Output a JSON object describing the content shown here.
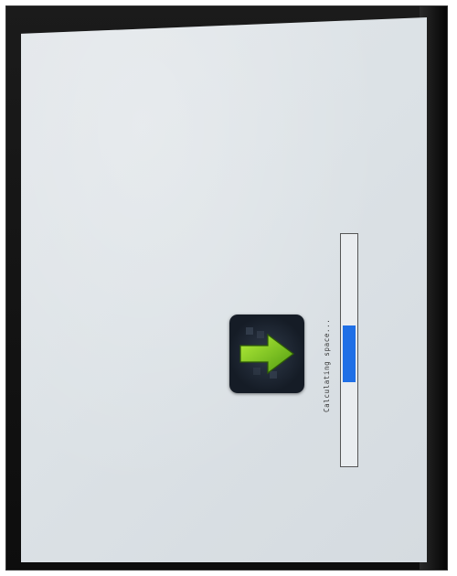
{
  "screen": {
    "status_text": "Calculating space...",
    "progress_fraction": 0.25,
    "progress_offset_fraction": 0.39,
    "icon": {
      "name": "update-arrow-icon",
      "arrow_color": "#7cc520",
      "background_color": "#1a2230"
    },
    "progress_color": "#1f6fe6"
  }
}
